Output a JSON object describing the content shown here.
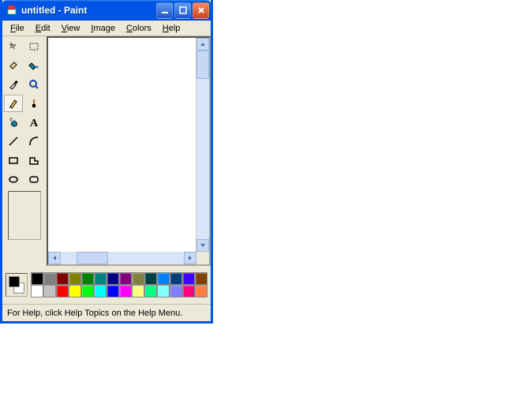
{
  "window": {
    "title": "untitled - Paint",
    "app_icon": "paint-cup-icon"
  },
  "menus": [
    "File",
    "Edit",
    "View",
    "Image",
    "Colors",
    "Help"
  ],
  "menu_accel_index": [
    0,
    0,
    0,
    0,
    0,
    0
  ],
  "tools": [
    {
      "name": "free-select",
      "icon": "star"
    },
    {
      "name": "rect-select",
      "icon": "rect-dash"
    },
    {
      "name": "eraser",
      "icon": "eraser"
    },
    {
      "name": "fill",
      "icon": "bucket"
    },
    {
      "name": "picker",
      "icon": "dropper"
    },
    {
      "name": "magnifier",
      "icon": "magnify"
    },
    {
      "name": "pencil",
      "icon": "pencil",
      "selected": true
    },
    {
      "name": "brush",
      "icon": "brush"
    },
    {
      "name": "airbrush",
      "icon": "spray"
    },
    {
      "name": "text",
      "icon": "text"
    },
    {
      "name": "line",
      "icon": "line"
    },
    {
      "name": "curve",
      "icon": "curve"
    },
    {
      "name": "rectangle",
      "icon": "rect"
    },
    {
      "name": "polygon",
      "icon": "poly"
    },
    {
      "name": "ellipse",
      "icon": "ellipse"
    },
    {
      "name": "rounded-rect",
      "icon": "rrect"
    }
  ],
  "colors": {
    "fg": "#000000",
    "bg": "#ffffff",
    "row1": [
      "#000000",
      "#808080",
      "#800000",
      "#808000",
      "#008000",
      "#008080",
      "#000080",
      "#800080",
      "#808040",
      "#004040",
      "#0080ff",
      "#004080",
      "#4000ff",
      "#804000"
    ],
    "row2": [
      "#ffffff",
      "#c0c0c0",
      "#ff0000",
      "#ffff00",
      "#00ff00",
      "#00ffff",
      "#0000ff",
      "#ff00ff",
      "#ffff80",
      "#00ff80",
      "#80ffff",
      "#8080ff",
      "#ff0080",
      "#ff8040"
    ]
  },
  "status": "For Help, click Help Topics on the Help Menu."
}
